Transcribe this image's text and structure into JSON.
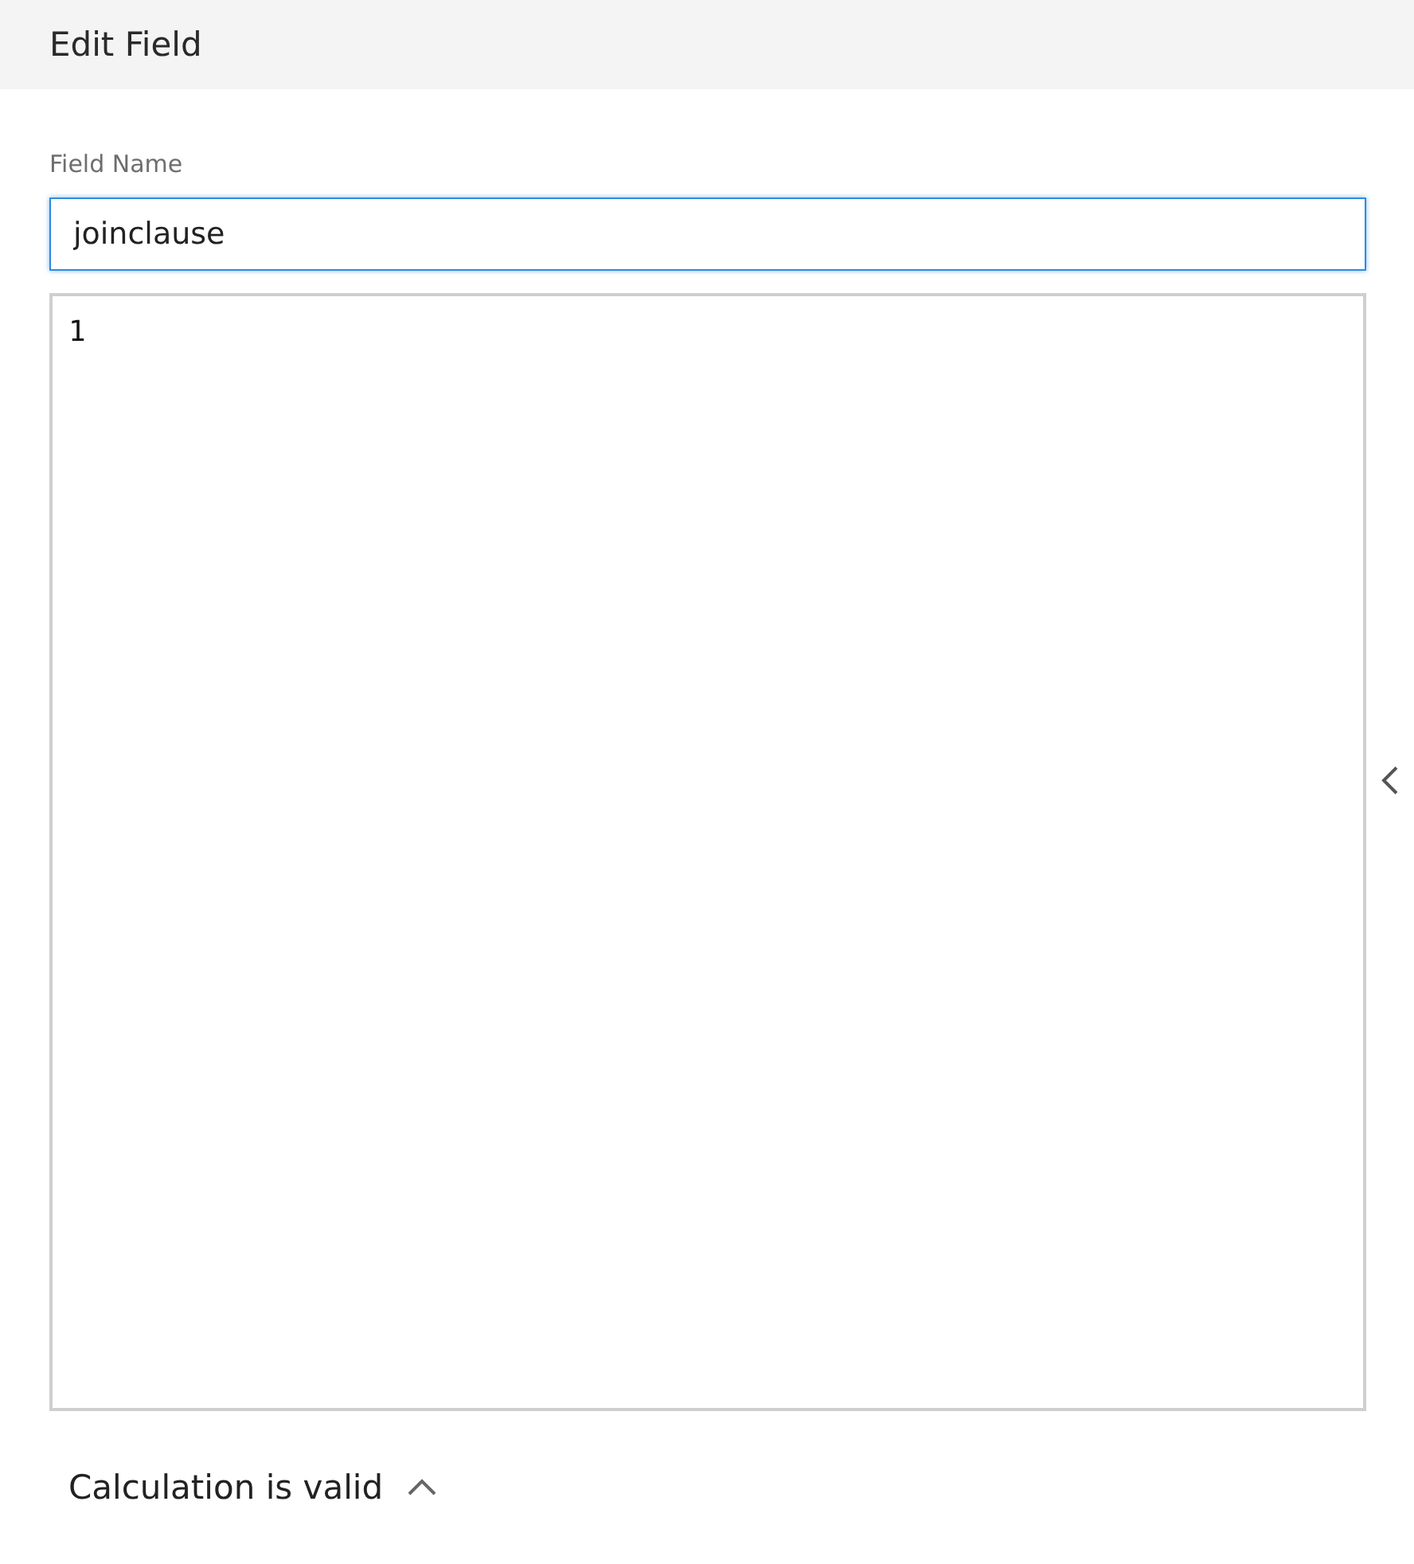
{
  "header": {
    "title": "Edit Field"
  },
  "field_name": {
    "label": "Field Name",
    "value": "joinclause"
  },
  "editor": {
    "lines": [
      "1"
    ]
  },
  "status": {
    "text": "Calculation is valid"
  }
}
